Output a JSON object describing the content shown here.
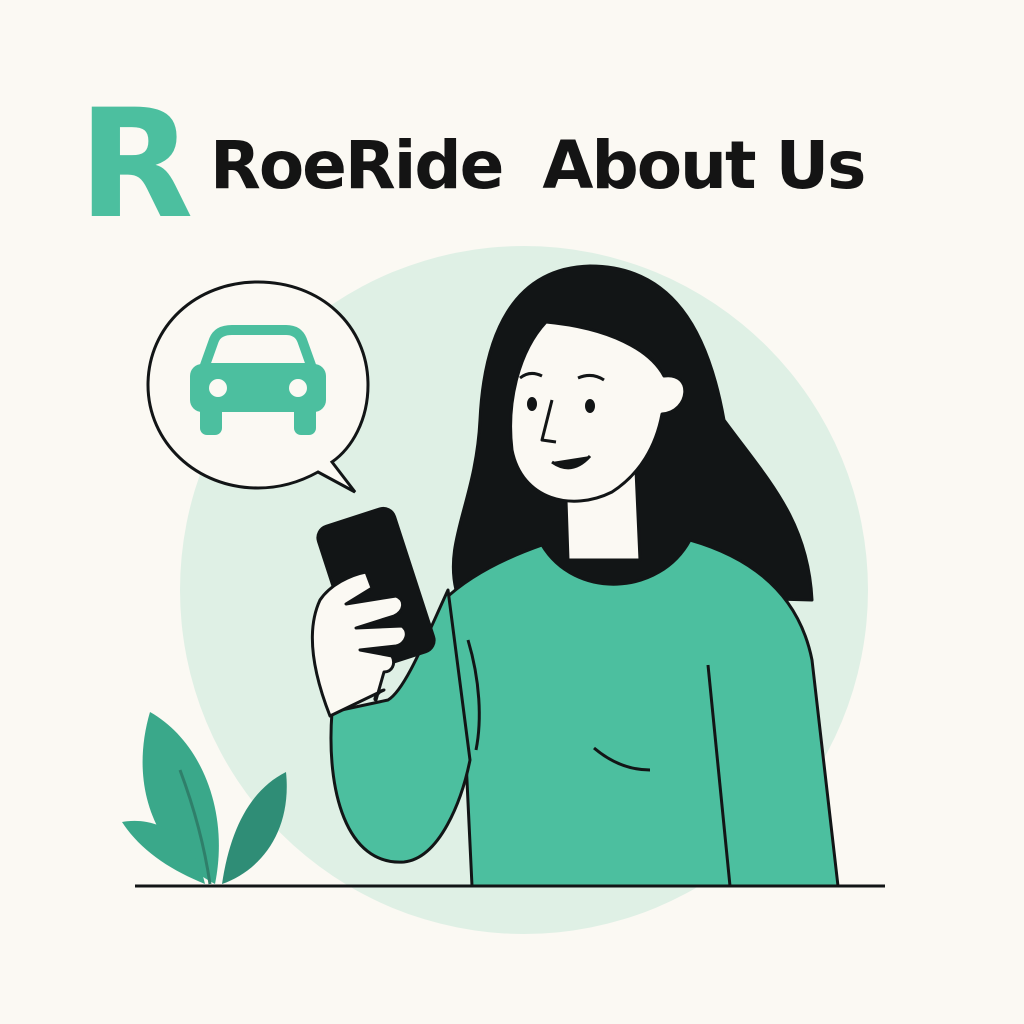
{
  "header": {
    "logo_letter": "R",
    "brand_name": "RoeRide",
    "page_title": "About Us"
  },
  "colors": {
    "accent": "#4cbf9f",
    "accent_dark": "#2f8d76",
    "background": "#fbf9f3",
    "circle": "#dff0e5",
    "ink": "#121516"
  },
  "illustration": {
    "speech_bubble_icon": "car-icon",
    "subject": "woman-holding-phone",
    "decoration": "plant-icon"
  }
}
